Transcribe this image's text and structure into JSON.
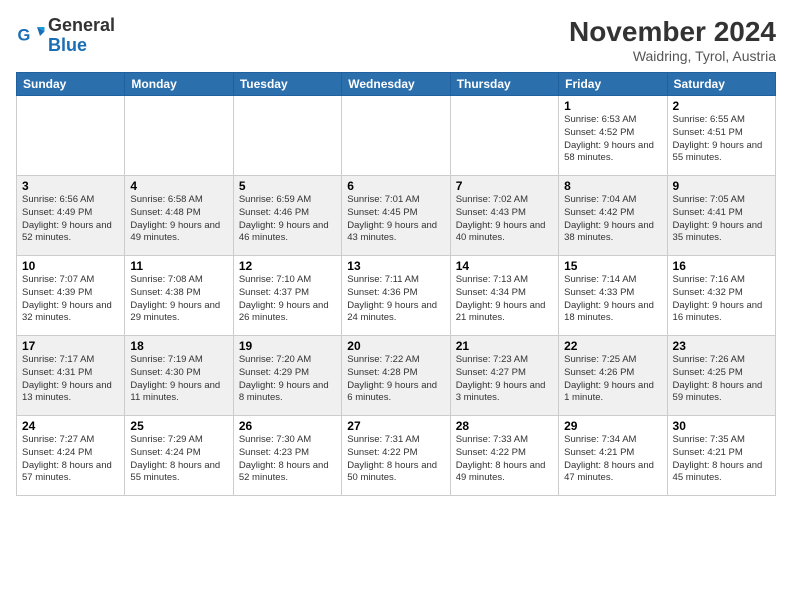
{
  "logo": {
    "line1": "General",
    "line2": "Blue"
  },
  "header": {
    "title": "November 2024",
    "subtitle": "Waidring, Tyrol, Austria"
  },
  "weekdays": [
    "Sunday",
    "Monday",
    "Tuesday",
    "Wednesday",
    "Thursday",
    "Friday",
    "Saturday"
  ],
  "weeks": [
    [
      {
        "day": "",
        "info": ""
      },
      {
        "day": "",
        "info": ""
      },
      {
        "day": "",
        "info": ""
      },
      {
        "day": "",
        "info": ""
      },
      {
        "day": "",
        "info": ""
      },
      {
        "day": "1",
        "info": "Sunrise: 6:53 AM\nSunset: 4:52 PM\nDaylight: 9 hours and 58 minutes."
      },
      {
        "day": "2",
        "info": "Sunrise: 6:55 AM\nSunset: 4:51 PM\nDaylight: 9 hours and 55 minutes."
      }
    ],
    [
      {
        "day": "3",
        "info": "Sunrise: 6:56 AM\nSunset: 4:49 PM\nDaylight: 9 hours and 52 minutes."
      },
      {
        "day": "4",
        "info": "Sunrise: 6:58 AM\nSunset: 4:48 PM\nDaylight: 9 hours and 49 minutes."
      },
      {
        "day": "5",
        "info": "Sunrise: 6:59 AM\nSunset: 4:46 PM\nDaylight: 9 hours and 46 minutes."
      },
      {
        "day": "6",
        "info": "Sunrise: 7:01 AM\nSunset: 4:45 PM\nDaylight: 9 hours and 43 minutes."
      },
      {
        "day": "7",
        "info": "Sunrise: 7:02 AM\nSunset: 4:43 PM\nDaylight: 9 hours and 40 minutes."
      },
      {
        "day": "8",
        "info": "Sunrise: 7:04 AM\nSunset: 4:42 PM\nDaylight: 9 hours and 38 minutes."
      },
      {
        "day": "9",
        "info": "Sunrise: 7:05 AM\nSunset: 4:41 PM\nDaylight: 9 hours and 35 minutes."
      }
    ],
    [
      {
        "day": "10",
        "info": "Sunrise: 7:07 AM\nSunset: 4:39 PM\nDaylight: 9 hours and 32 minutes."
      },
      {
        "day": "11",
        "info": "Sunrise: 7:08 AM\nSunset: 4:38 PM\nDaylight: 9 hours and 29 minutes."
      },
      {
        "day": "12",
        "info": "Sunrise: 7:10 AM\nSunset: 4:37 PM\nDaylight: 9 hours and 26 minutes."
      },
      {
        "day": "13",
        "info": "Sunrise: 7:11 AM\nSunset: 4:36 PM\nDaylight: 9 hours and 24 minutes."
      },
      {
        "day": "14",
        "info": "Sunrise: 7:13 AM\nSunset: 4:34 PM\nDaylight: 9 hours and 21 minutes."
      },
      {
        "day": "15",
        "info": "Sunrise: 7:14 AM\nSunset: 4:33 PM\nDaylight: 9 hours and 18 minutes."
      },
      {
        "day": "16",
        "info": "Sunrise: 7:16 AM\nSunset: 4:32 PM\nDaylight: 9 hours and 16 minutes."
      }
    ],
    [
      {
        "day": "17",
        "info": "Sunrise: 7:17 AM\nSunset: 4:31 PM\nDaylight: 9 hours and 13 minutes."
      },
      {
        "day": "18",
        "info": "Sunrise: 7:19 AM\nSunset: 4:30 PM\nDaylight: 9 hours and 11 minutes."
      },
      {
        "day": "19",
        "info": "Sunrise: 7:20 AM\nSunset: 4:29 PM\nDaylight: 9 hours and 8 minutes."
      },
      {
        "day": "20",
        "info": "Sunrise: 7:22 AM\nSunset: 4:28 PM\nDaylight: 9 hours and 6 minutes."
      },
      {
        "day": "21",
        "info": "Sunrise: 7:23 AM\nSunset: 4:27 PM\nDaylight: 9 hours and 3 minutes."
      },
      {
        "day": "22",
        "info": "Sunrise: 7:25 AM\nSunset: 4:26 PM\nDaylight: 9 hours and 1 minute."
      },
      {
        "day": "23",
        "info": "Sunrise: 7:26 AM\nSunset: 4:25 PM\nDaylight: 8 hours and 59 minutes."
      }
    ],
    [
      {
        "day": "24",
        "info": "Sunrise: 7:27 AM\nSunset: 4:24 PM\nDaylight: 8 hours and 57 minutes."
      },
      {
        "day": "25",
        "info": "Sunrise: 7:29 AM\nSunset: 4:24 PM\nDaylight: 8 hours and 55 minutes."
      },
      {
        "day": "26",
        "info": "Sunrise: 7:30 AM\nSunset: 4:23 PM\nDaylight: 8 hours and 52 minutes."
      },
      {
        "day": "27",
        "info": "Sunrise: 7:31 AM\nSunset: 4:22 PM\nDaylight: 8 hours and 50 minutes."
      },
      {
        "day": "28",
        "info": "Sunrise: 7:33 AM\nSunset: 4:22 PM\nDaylight: 8 hours and 49 minutes."
      },
      {
        "day": "29",
        "info": "Sunrise: 7:34 AM\nSunset: 4:21 PM\nDaylight: 8 hours and 47 minutes."
      },
      {
        "day": "30",
        "info": "Sunrise: 7:35 AM\nSunset: 4:21 PM\nDaylight: 8 hours and 45 minutes."
      }
    ]
  ]
}
